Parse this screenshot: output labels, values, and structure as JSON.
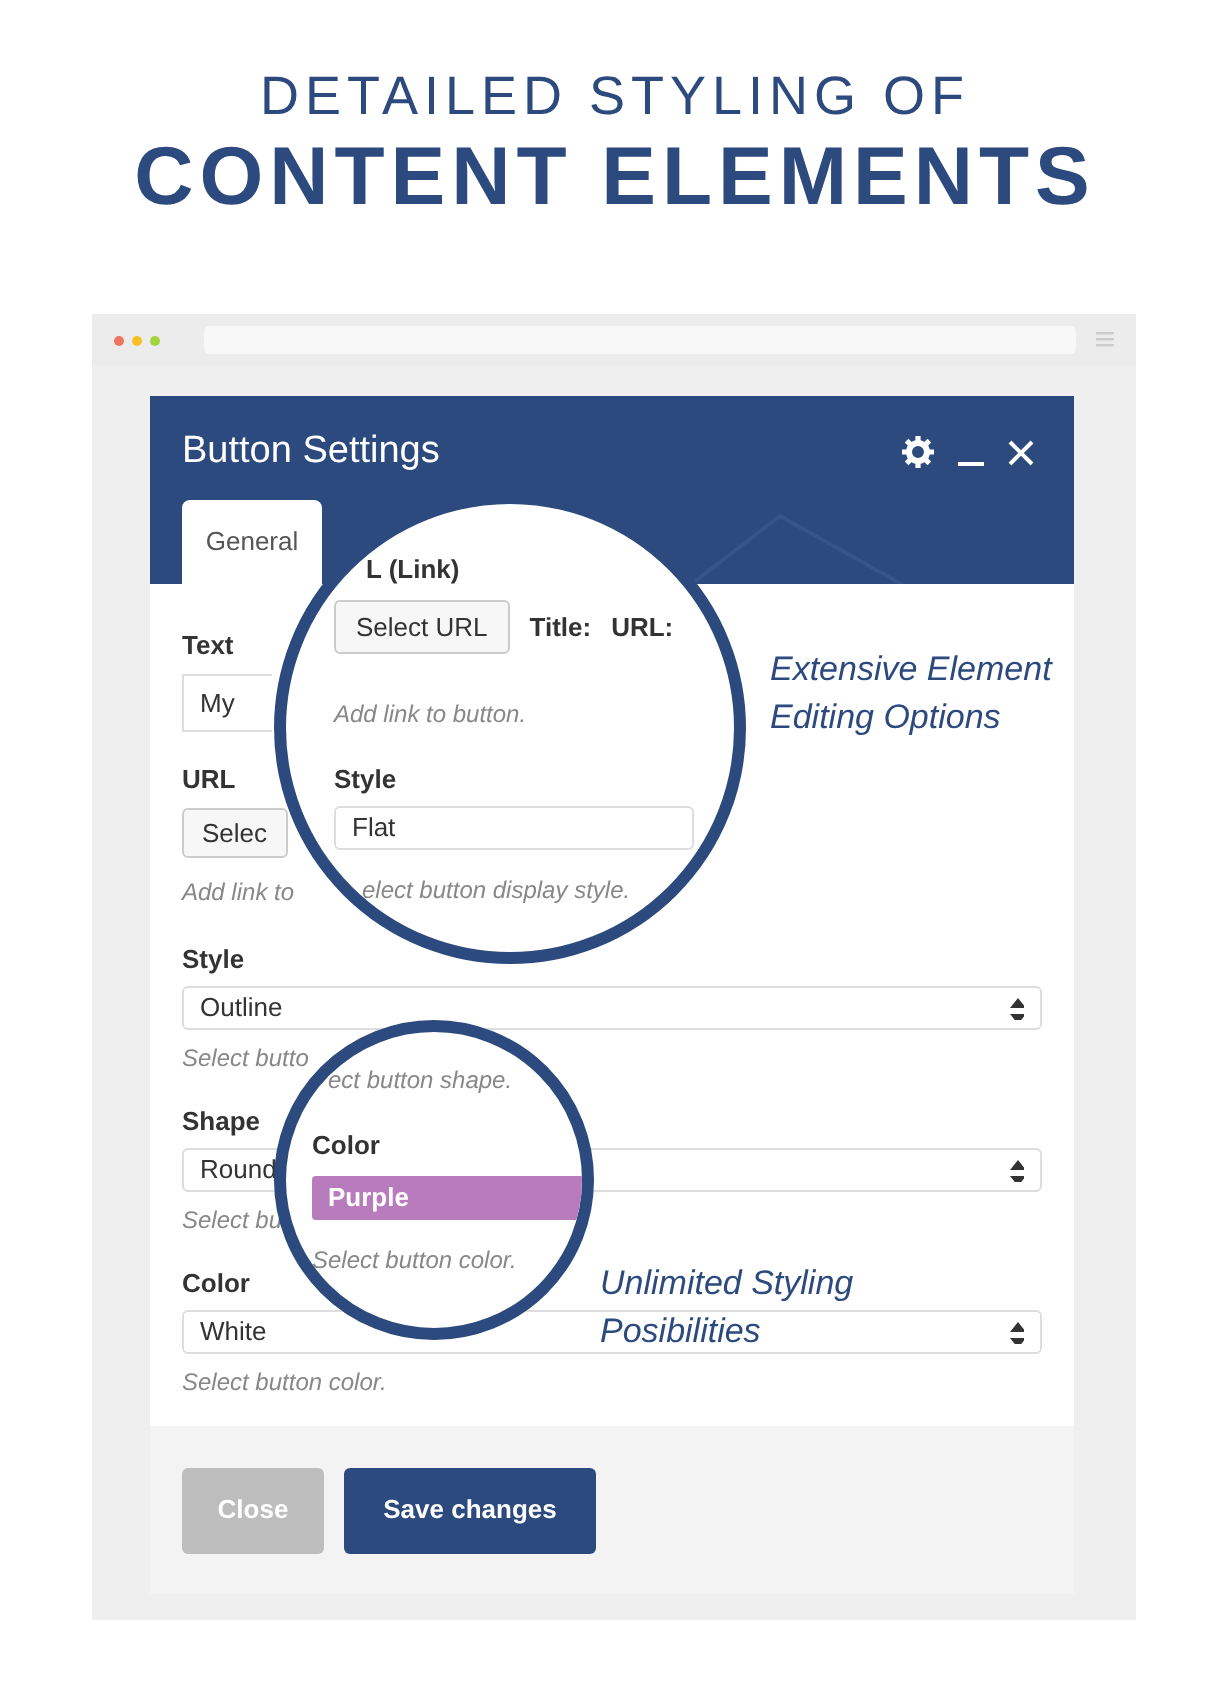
{
  "headline": {
    "line_1": "DETAILED STYLING OF",
    "line_2": "CONTENT ELEMENTS"
  },
  "dialog": {
    "title": "Button Settings",
    "tabs": [
      {
        "label": "General",
        "selected": true
      }
    ],
    "fields": [
      {
        "kind": "text",
        "label": "Text",
        "value": "My"
      },
      {
        "kind": "url",
        "label": "URL",
        "button": "Selec",
        "hint": "Add link to"
      },
      {
        "kind": "select",
        "label": "Style",
        "value": "Outline",
        "hint": "Select butto"
      },
      {
        "kind": "select",
        "label": "Shape",
        "value": "Round",
        "hint": "Select bu"
      },
      {
        "kind": "select",
        "label": "Color",
        "value": "White",
        "hint": "Select button color."
      }
    ],
    "buttons": [
      {
        "label": "Close",
        "kind": "secondary"
      },
      {
        "label": "Save changes",
        "kind": "primary"
      }
    ]
  },
  "magnifiers": [
    {
      "items": [
        {
          "kind": "label",
          "text": "L (Link)"
        },
        {
          "kind": "url",
          "button": "Select URL",
          "title_label": "Title:",
          "url_label": "URL:"
        },
        {
          "kind": "hint",
          "text": "Add link to button."
        },
        {
          "kind": "label",
          "text": "Style"
        },
        {
          "kind": "select",
          "value": "Flat"
        },
        {
          "kind": "hint",
          "text": "elect button display style."
        }
      ]
    },
    {
      "items": [
        {
          "kind": "hint",
          "text": "ect button shape."
        },
        {
          "kind": "label",
          "text": "Color"
        },
        {
          "kind": "select",
          "value": "Purple",
          "color": "#b87bbb"
        },
        {
          "kind": "hint",
          "text": "Select button color."
        }
      ]
    }
  ],
  "annotations": [
    {
      "lines": [
        "Extensive Element",
        "Editing Options"
      ]
    },
    {
      "lines": [
        "Unlimited Styling",
        "Posibilities"
      ]
    }
  ]
}
